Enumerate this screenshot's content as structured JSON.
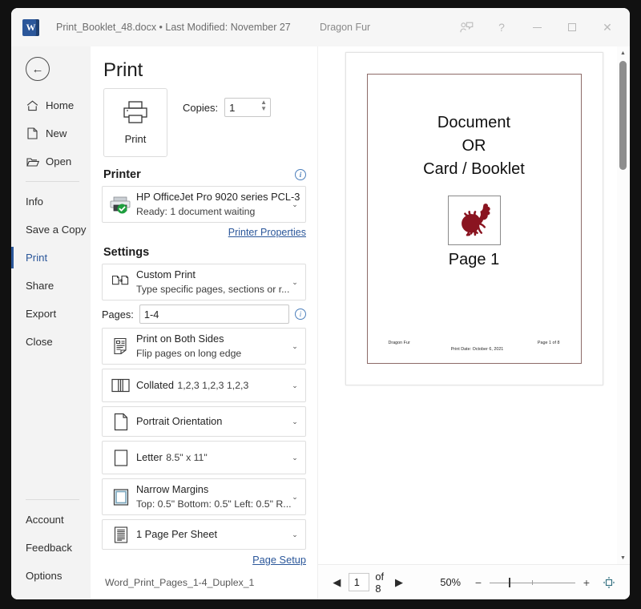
{
  "titlebar": {
    "doc_title": "Print_Booklet_48.docx • Last Modified: November 27",
    "user_name": "Dragon Fur",
    "word_icon_letter": "W",
    "icons": {
      "share": "share-person-icon",
      "help": "?",
      "minimize": "minimize-icon",
      "maximize": "maximize-icon",
      "close": "✕"
    }
  },
  "sidebar": {
    "back_label": "←",
    "items": [
      {
        "label": "Home",
        "icon": "home-icon"
      },
      {
        "label": "New",
        "icon": "new-document-icon"
      },
      {
        "label": "Open",
        "icon": "open-folder-icon"
      }
    ],
    "items2": [
      {
        "label": "Info"
      },
      {
        "label": "Save a Copy"
      },
      {
        "label": "Print",
        "active": true
      },
      {
        "label": "Share"
      },
      {
        "label": "Export"
      },
      {
        "label": "Close"
      }
    ],
    "items3": [
      {
        "label": "Account"
      },
      {
        "label": "Feedback"
      },
      {
        "label": "Options"
      }
    ]
  },
  "settings": {
    "page_title": "Print",
    "print_button_label": "Print",
    "copies_label": "Copies:",
    "copies_value": "1",
    "printer_section_label": "Printer",
    "printer_name": "HP OfficeJet Pro 9020 series PCL-3",
    "printer_status": "Ready: 1 document waiting",
    "printer_properties_link": "Printer Properties",
    "settings_section_label": "Settings",
    "options": [
      {
        "name": "print-range",
        "title": "Custom Print",
        "subtitle": "Type specific pages, sections or r...",
        "icon": "custom-print-icon"
      },
      {
        "name": "duplex",
        "title": "Print on Both Sides",
        "subtitle": "Flip pages on long edge",
        "icon": "duplex-icon"
      },
      {
        "name": "collation",
        "title": "Collated",
        "subtitle": "1,2,3   1,2,3   1,2,3",
        "icon": "collated-icon"
      },
      {
        "name": "orientation",
        "title": "Portrait Orientation",
        "subtitle": "",
        "icon": "portrait-icon"
      },
      {
        "name": "paper-size",
        "title": "Letter",
        "subtitle": "8.5\" x 11\"",
        "icon": "paper-icon"
      },
      {
        "name": "margins",
        "title": "Narrow Margins",
        "subtitle": "Top: 0.5\" Bottom: 0.5\" Left: 0.5\" R...",
        "icon": "margins-icon"
      },
      {
        "name": "pages-per-sheet",
        "title": "1 Page Per Sheet",
        "subtitle": "",
        "icon": "scale-icon"
      }
    ],
    "pages_label": "Pages:",
    "pages_value": "1-4",
    "page_setup_link": "Page Setup",
    "footer_note": "Word_Print_Pages_1-4_Duplex_1"
  },
  "preview": {
    "doc_line1": "Document",
    "doc_line2": "OR",
    "doc_line3": "Card / Booklet",
    "page_label": "Page 1",
    "image_alt": "rooster-illustration",
    "image_color": "#8a1420",
    "footer_left": "Dragon Fur",
    "footer_right": "Page 1 of  8",
    "footer_center": "Print Date:  October 6, 2021"
  },
  "bottombar": {
    "prev_label": "◀",
    "next_label": "▶",
    "current_page": "1",
    "of_label": "of 8",
    "zoom_percent": "50%",
    "zoom_out": "−",
    "zoom_in": "+",
    "fit_label": "zoom-to-page-icon"
  }
}
